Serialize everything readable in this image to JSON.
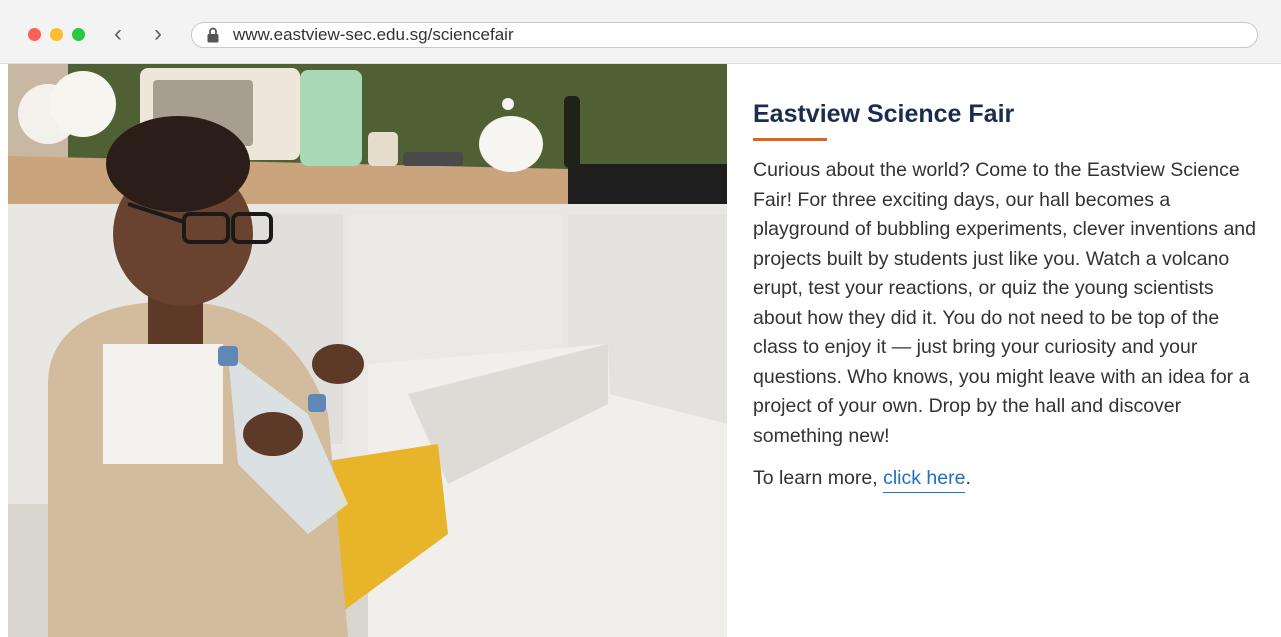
{
  "browser": {
    "url": "www.eastview-sec.edu.sg/sciencefair",
    "back_label": "‹",
    "forward_label": "›"
  },
  "photo": {
    "kind": "boy sorting plastic bottles into a recycling bin in a kitchen"
  },
  "article": {
    "title": "Eastview Science Fair",
    "body": "Curious about the world? Come to the Eastview Science Fair! For three exciting days, our hall becomes a playground of bubbling experiments, clever inventions and projects built by students just like you. Watch a volcano erupt, test your reactions, or quiz the young scientists about how they did it. You do not need to be top of the class to enjoy it — just bring your curiosity and your questions. Who knows, you might leave with an idea for a project of your own. Drop by the hall and discover something new!",
    "more_prefix": "To learn more, ",
    "more_link": "click here",
    "more_suffix": "."
  },
  "colors": {
    "title": "#1b2d4f",
    "accent_rule": "#d9651f",
    "link": "#1f6fc4"
  }
}
